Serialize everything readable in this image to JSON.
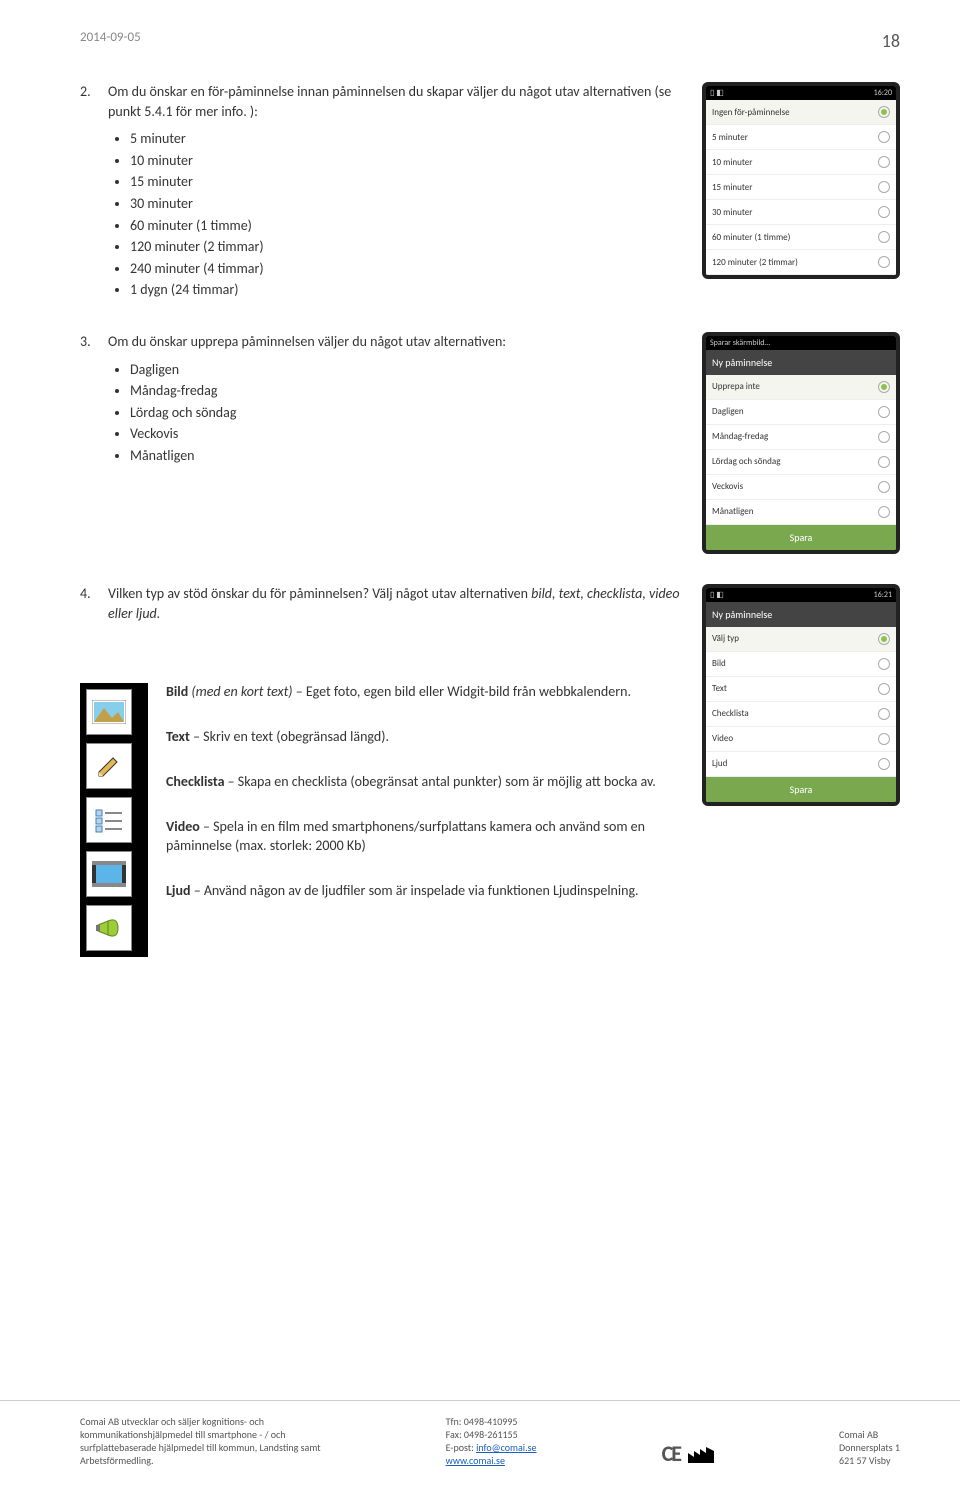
{
  "header": {
    "date": "2014-09-05",
    "page": "18"
  },
  "section2": {
    "num": "2.",
    "text_a": "Om du önskar en för-påminnelse innan påminnelsen du skapar väljer du något utav alternativen (se punkt 5.4.1 för mer info. ):",
    "bullets": [
      "5 minuter",
      "10 minuter",
      "15 minuter",
      "30 minuter",
      "60 minuter (1 timme)",
      "120 minuter (2 timmar)",
      "240 minuter (4 timmar)",
      "1 dygn (24 timmar)"
    ]
  },
  "phone1": {
    "time": "16:20",
    "opts": [
      "Ingen för-påminnelse",
      "5 minuter",
      "10 minuter",
      "15 minuter",
      "30 minuter",
      "60 minuter (1 timme)",
      "120 minuter (2 timmar)"
    ],
    "selected": 0
  },
  "section3": {
    "num": "3.",
    "text": "Om du önskar upprepa påminnelsen väljer du något utav alternativen:",
    "bullets": [
      "Dagligen",
      "Måndag-fredag",
      "Lördag och söndag",
      "Veckovis",
      "Månatligen"
    ]
  },
  "phone2": {
    "title_bar": "Sparar skärmbild…",
    "title": "Ny påminnelse",
    "opts": [
      "Upprepa inte",
      "Dagligen",
      "Måndag-fredag",
      "Lördag och söndag",
      "Veckovis",
      "Månatligen"
    ],
    "selected": 0,
    "spara": "Spara"
  },
  "section4": {
    "num": "4.",
    "text_a": "Vilken typ av stöd önskar du för påminnelsen? Välj något utav alternativen ",
    "text_b_italic": "bild, text, checklista, video eller ljud."
  },
  "phone3": {
    "time": "16:21",
    "title": "Ny påminnelse",
    "opts": [
      "Välj typ",
      "Bild",
      "Text",
      "Checklista",
      "Video",
      "Ljud"
    ],
    "selected": 0,
    "spara": "Spara"
  },
  "descriptions": {
    "bild_b": "Bild ",
    "bild_i": "(med en kort text)",
    "bild_t": " – Eget foto, egen bild eller Widgit-bild från webbkalendern.",
    "text_b": "Text",
    "text_t": " – Skriv en text (obegränsad längd).",
    "check_b": "Checklista",
    "check_t": " – Skapa en checklista (obegränsat antal punkter)  som är möjlig att bocka av.",
    "video_b": "Video",
    "video_t": " – Spela in en film med smartphonens/surfplattans kamera och använd som en påminnelse (max. storlek: 2000 Kb)",
    "ljud_b": "Ljud",
    "ljud_t": " – Använd någon av de ljudfiler som är inspelade via funktionen Ljudinspelning."
  },
  "footer": {
    "left1": "Comai AB utvecklar och säljer kognitions- och",
    "left2": "kommunikationshjälpmedel till smartphone - / och",
    "left3": "surfplattebaserade hjälpmedel till kommun, Landsting samt",
    "left4": "Arbetsförmedling.",
    "mid1": "Tfn: 0498-410995",
    "mid2": "Fax: 0498-261155",
    "mid3a": "E-post: ",
    "mid3b": "info@comai.se",
    "mid4": "www.comai.se",
    "right1": "Comai AB",
    "right2": "Donnersplats 1",
    "right3": "621 57 Visby"
  }
}
